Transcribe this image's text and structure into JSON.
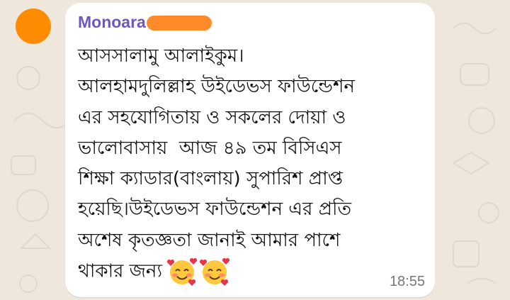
{
  "chat": {
    "sender": "Monoara",
    "message_lines": [
      "আসসালামু আলাইকুম।",
      "আলহামদুলিল্লাহ উইডেভস ফাউন্ডেশন",
      "এর সহযোগিতায় ও সকলের দোয়া ও",
      "ভালোবাসায়  আজ ৪৯ তম বিসিএস",
      "শিক্ষা ক্যাডার(বাংলায়) সুপারিশ প্রাপ্ত",
      "হয়েছি।উইডেভস ফাউন্ডেশন এর প্রতি",
      "অশেষ কৃতজ্ঞতা জানাই আমার পাশে",
      "থাকার জন্য"
    ],
    "emojis": [
      "smiling-face-with-hearts",
      "smiling-face-with-hearts"
    ],
    "time": "18:55"
  },
  "colors": {
    "sender": "#6e58bf",
    "avatar": "#ff8c00",
    "redaction": "#ff8a2a",
    "bubble": "#ffffff",
    "wallpaper": "#efe7dc"
  }
}
